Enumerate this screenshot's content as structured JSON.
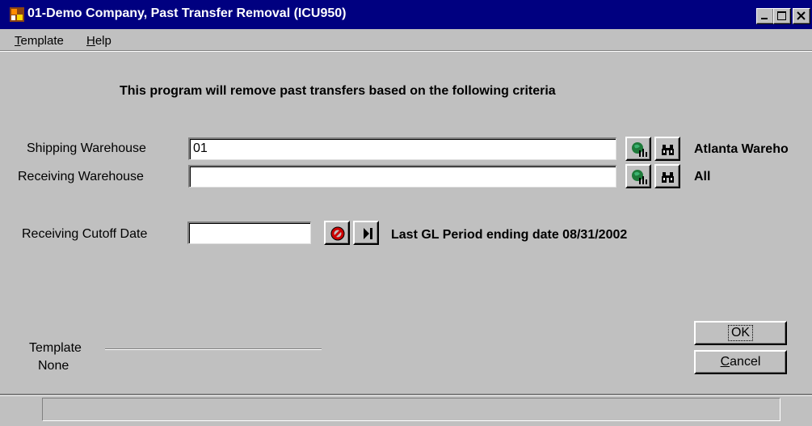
{
  "window": {
    "title": "01-Demo Company, Past Transfer Removal (ICU950)"
  },
  "menu": [
    {
      "label_first": "T",
      "label_rest": "emplate"
    },
    {
      "label_first": "H",
      "label_rest": "elp"
    }
  ],
  "heading": "This program will remove past transfers based on the following criteria",
  "shipping": {
    "label": "Shipping Warehouse",
    "value": "01",
    "description": "Atlanta Wareho"
  },
  "receiving": {
    "label": "Receiving Warehouse",
    "value": "",
    "description": "All"
  },
  "cutoff": {
    "label": "Receiving Cutoff Date",
    "value": "",
    "note": "Last GL Period ending date 08/31/2002"
  },
  "template": {
    "label": "Template",
    "value": "None"
  },
  "buttons": {
    "ok": "OK",
    "cancel_first": "C",
    "cancel_rest": "ancel"
  },
  "icons": {
    "app": "program-icon",
    "lookup_all": "globe-all-icon",
    "search": "binoculars-icon",
    "clear_date": "no-entry-icon",
    "next_date": "skip-forward-icon"
  },
  "colors": {
    "titlebar": "#000080",
    "face": "#c0c0c0"
  }
}
